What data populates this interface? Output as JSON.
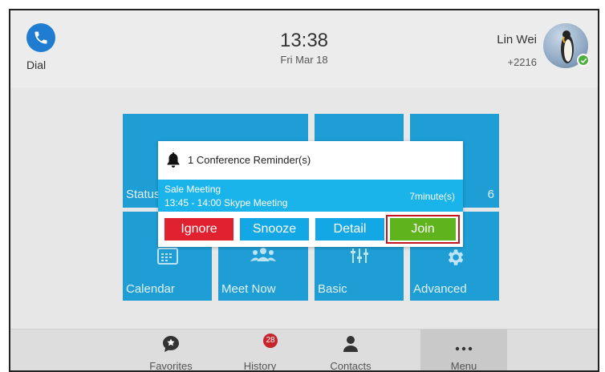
{
  "header": {
    "dial_label": "Dial",
    "time": "13:38",
    "date": "Fri Mar 18",
    "account_name": "Lin Wei",
    "account_ext": "+2216"
  },
  "tiles": {
    "status": "Status",
    "six": "6",
    "calendar": "Calendar",
    "meet_now": "Meet Now",
    "basic": "Basic",
    "advanced": "Advanced"
  },
  "dialog": {
    "title": "1 Conference Reminder(s)",
    "meeting_name": "Sale Meeting",
    "meeting_time": "13:45 - 14:00 Skype Meeting",
    "time_left": "7minute(s)",
    "ignore": "Ignore",
    "snooze": "Snooze",
    "detail": "Detail",
    "join": "Join"
  },
  "nav": {
    "favorites": "Favorites",
    "history": "History",
    "history_badge": "28",
    "contacts": "Contacts",
    "menu": "Menu"
  },
  "colors": {
    "tile": "#1f9ed6",
    "dial": "#1f7cd1",
    "ignore": "#e0212f",
    "snooze": "#13a8e5",
    "join": "#5fb31d",
    "join_outline": "#c4161c",
    "badge": "#c8242b",
    "presence": "#4cae3c"
  },
  "icons": {
    "dial": "phone-icon",
    "reminder": "bell-icon",
    "calendar": "calendar-icon",
    "meet_now": "people-icon",
    "basic": "sliders-icon",
    "advanced": "gear-icon",
    "favorites": "star-bubble-icon",
    "history": "history-icon",
    "contacts": "person-icon",
    "menu": "more-dots-icon"
  }
}
